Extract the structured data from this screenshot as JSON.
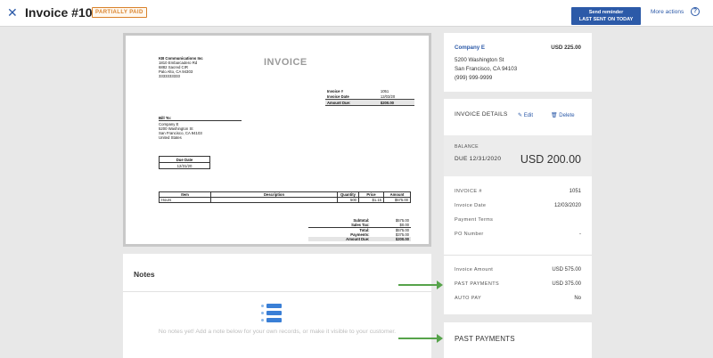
{
  "header": {
    "close_glyph": "✕",
    "title": "Invoice #1051",
    "status_badge": "PARTIALLY PAID",
    "send_reminder_label": "Send reminder",
    "send_reminder_sub": "LAST SENT ON TODAY",
    "more_actions_label": "More actions",
    "help_glyph": "?"
  },
  "invoice_doc": {
    "sender_name": "KB Communications Inc",
    "sender_line1": "1810 Embarcadero Rd",
    "sender_line2": "6882 Sacred CIR",
    "sender_line3": "Palo Alto, CA 94303",
    "sender_phone": "3333333333",
    "heading": "INVOICE",
    "meta": [
      {
        "label": "Invoice #",
        "value": "1051"
      },
      {
        "label": "Invoice Date",
        "value": "12/03/20"
      },
      {
        "label": "Amount Due:",
        "value": "$200.00"
      }
    ],
    "bill_to_heading": "Bill To:",
    "bill_to_line1": "Company E",
    "bill_to_line2": "5200 Washington St",
    "bill_to_line3": "San Francisco, CA 94103",
    "bill_to_line4": "United States",
    "due_date_heading": "Due Date",
    "due_date_value": "12/31/20",
    "items_headers": {
      "item": "Item",
      "description": "Description",
      "quantity": "Quantity",
      "price": "Price",
      "amount": "Amount"
    },
    "items": [
      {
        "item": "Hours",
        "description": "",
        "quantity": "500",
        "price": "$1.15",
        "amount": "$575.00"
      }
    ],
    "totals": [
      {
        "label": "Subtotal:",
        "value": "$575.00"
      },
      {
        "label": "Sales Tax:",
        "value": "$0.00"
      },
      {
        "label": "Total:",
        "value": "$575.00"
      },
      {
        "label": "Payments:",
        "value": "$375.00"
      },
      {
        "label": "Amount Due:",
        "value": "$200.00"
      }
    ]
  },
  "notes": {
    "heading": "Notes",
    "empty_text": "No notes yet! Add a note below for your own records, or make it visible to your customer."
  },
  "customer_card": {
    "name": "Company E",
    "amount": "USD 225.00",
    "address_line1": "5200 Washington St",
    "address_line2": "San Francisco, CA 94103",
    "phone": "(999) 999-9999"
  },
  "invoice_details": {
    "heading": "INVOICE DETAILS",
    "edit_label": "Edit",
    "delete_label": "Delete",
    "balance_label": "BALANCE",
    "due_label": "DUE 12/31/2020",
    "balance_amount": "USD 200.00",
    "rows": [
      {
        "label": "INVOICE #",
        "value": "1051"
      },
      {
        "label": "Invoice Date",
        "value": "12/03/2020"
      },
      {
        "label": "Payment Terms",
        "value": ""
      },
      {
        "label": "PO Number",
        "value": "-"
      }
    ],
    "rows2": [
      {
        "label": "Invoice Amount",
        "value": "USD 575.00"
      },
      {
        "label": "PAST PAYMENTS",
        "value": "USD 375.00"
      },
      {
        "label": "AUTO PAY",
        "value": "No"
      }
    ]
  },
  "past_payments_card": {
    "heading": "PAST PAYMENTS"
  },
  "colors": {
    "accent": "#2c5aa8",
    "badge": "#d9822b",
    "arrow": "#56a34a"
  },
  "icons": [
    "close-icon",
    "edit-pencil-icon",
    "trash-icon",
    "help-icon",
    "notes-list-icon"
  ]
}
